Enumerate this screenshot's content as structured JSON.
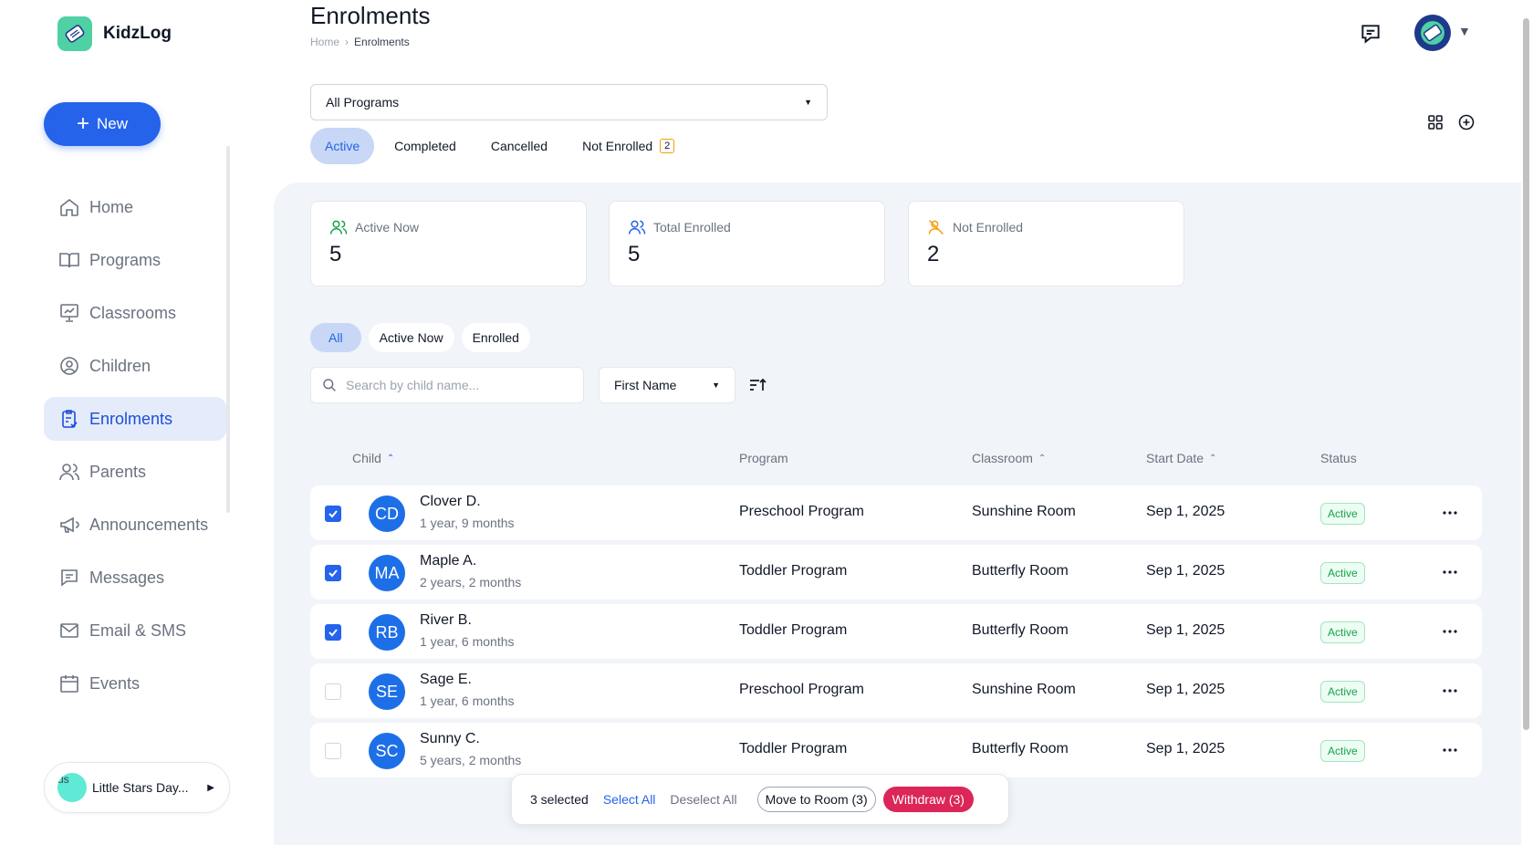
{
  "app": {
    "name": "KidzLog"
  },
  "sidebar": {
    "new_label": "New",
    "items": [
      {
        "label": "Home",
        "icon": "home-icon"
      },
      {
        "label": "Programs",
        "icon": "book-icon"
      },
      {
        "label": "Classrooms",
        "icon": "presentation-icon"
      },
      {
        "label": "Children",
        "icon": "user-circle-icon"
      },
      {
        "label": "Enrolments",
        "icon": "clipboard-check-icon",
        "active": true
      },
      {
        "label": "Parents",
        "icon": "users-icon"
      },
      {
        "label": "Announcements",
        "icon": "megaphone-icon"
      },
      {
        "label": "Messages",
        "icon": "message-icon"
      },
      {
        "label": "Email & SMS",
        "icon": "mail-icon"
      },
      {
        "label": "Events",
        "icon": "calendar-icon"
      }
    ],
    "school": {
      "avatar_alt": "us",
      "name": "Little Stars Day..."
    }
  },
  "header": {
    "title": "Enrolments",
    "breadcrumb": [
      "Home",
      "Enrolments"
    ]
  },
  "program_select": {
    "value": "All Programs"
  },
  "tabs": [
    {
      "label": "Active",
      "active": true
    },
    {
      "label": "Completed"
    },
    {
      "label": "Cancelled"
    },
    {
      "label": "Not Enrolled",
      "badge": "2"
    }
  ],
  "stats": [
    {
      "label": "Active Now",
      "value": "5",
      "icon": "users-icon",
      "color": "#16a34a"
    },
    {
      "label": "Total Enrolled",
      "value": "5",
      "icon": "users-icon",
      "color": "#2563eb"
    },
    {
      "label": "Not Enrolled",
      "value": "2",
      "icon": "user-x-icon",
      "color": "#f59e0b"
    }
  ],
  "filters": [
    {
      "label": "All",
      "active": true
    },
    {
      "label": "Active Now"
    },
    {
      "label": "Enrolled"
    }
  ],
  "search": {
    "placeholder": "Search by child name..."
  },
  "sort": {
    "value": "First Name"
  },
  "table": {
    "columns": {
      "child": "Child",
      "program": "Program",
      "classroom": "Classroom",
      "start_date": "Start Date",
      "status": "Status"
    },
    "rows": [
      {
        "checked": true,
        "initials": "CD",
        "name": "Clover D.",
        "age": "1 year, 9 months",
        "program": "Preschool Program",
        "classroom": "Sunshine Room",
        "start_date": "Sep 1, 2025",
        "status": "Active"
      },
      {
        "checked": true,
        "initials": "MA",
        "name": "Maple A.",
        "age": "2 years, 2 months",
        "program": "Toddler Program",
        "classroom": "Butterfly Room",
        "start_date": "Sep 1, 2025",
        "status": "Active"
      },
      {
        "checked": true,
        "initials": "RB",
        "name": "River B.",
        "age": "1 year, 6 months",
        "program": "Toddler Program",
        "classroom": "Butterfly Room",
        "start_date": "Sep 1, 2025",
        "status": "Active"
      },
      {
        "checked": false,
        "initials": "SE",
        "name": "Sage E.",
        "age": "1 year, 6 months",
        "program": "Preschool Program",
        "classroom": "Sunshine Room",
        "start_date": "Sep 1, 2025",
        "status": "Active"
      },
      {
        "checked": false,
        "initials": "SC",
        "name": "Sunny C.",
        "age": "5 years, 2 months",
        "program": "Toddler Program",
        "classroom": "Butterfly Room",
        "start_date": "Sep 1, 2025",
        "status": "Active"
      }
    ]
  },
  "bulk": {
    "selected": "3 selected",
    "select_all": "Select All",
    "deselect_all": "Deselect All",
    "move": "Move to Room (3)",
    "withdraw": "Withdraw (3)"
  },
  "colors": {
    "accent": "#2563eb",
    "danger": "#dc2658",
    "success": "#16a34a"
  }
}
